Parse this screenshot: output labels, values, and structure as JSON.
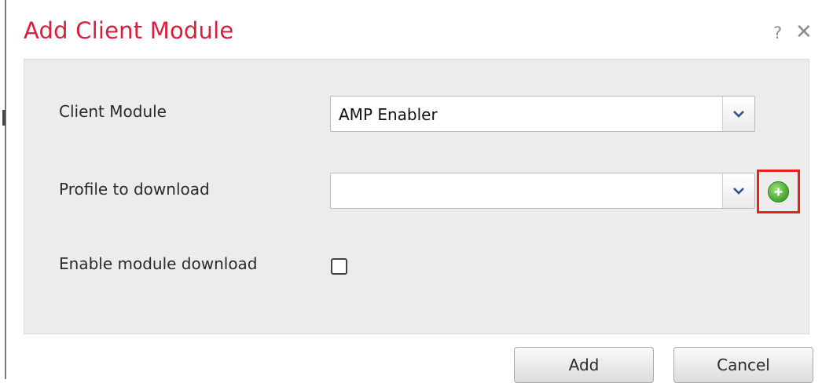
{
  "dialog": {
    "title": "Add Client Module",
    "help_label": "?",
    "close_label": "✕"
  },
  "form": {
    "client_module": {
      "label": "Client Module",
      "value": "AMP Enabler"
    },
    "profile": {
      "label": "Profile to download",
      "value": ""
    },
    "enable_download": {
      "label": "Enable module download",
      "checked": false
    }
  },
  "footer": {
    "add_label": "Add",
    "cancel_label": "Cancel"
  },
  "colors": {
    "title": "#d61f3a",
    "highlight": "#e8221b",
    "add_icon": "#4fae35",
    "panel": "#ececec"
  },
  "icons": {
    "help": "question-mark-icon",
    "close": "close-icon",
    "dropdown": "chevron-down-icon",
    "add_profile": "plus-circle-icon"
  }
}
